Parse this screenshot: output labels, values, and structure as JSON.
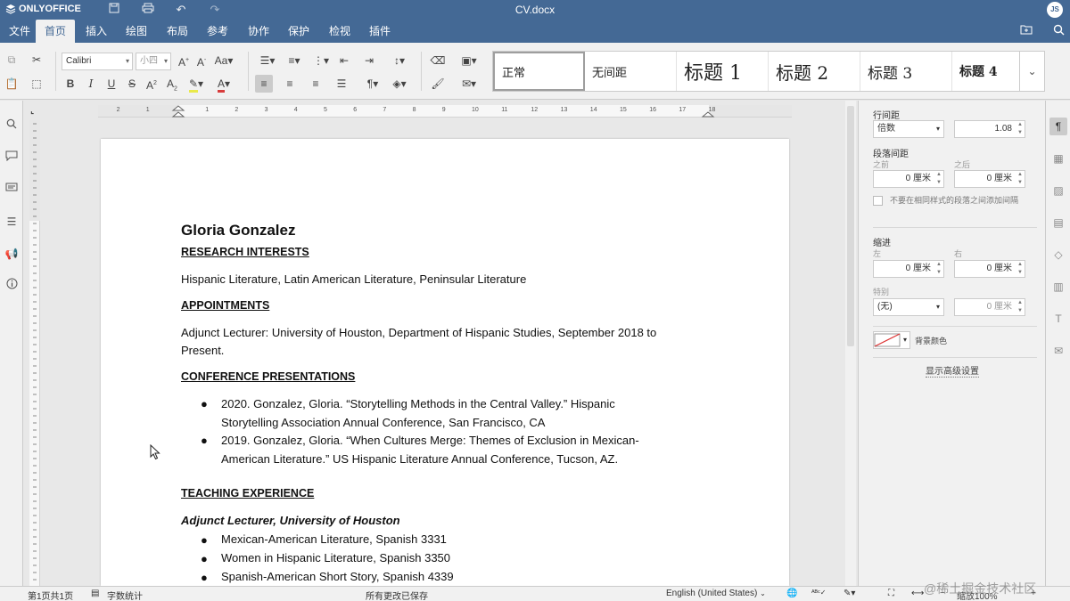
{
  "app": {
    "logo": "ONLYOFFICE",
    "doc_title": "CV.docx",
    "user_initials": "JS"
  },
  "menu": {
    "tabs": [
      "文件",
      "首页",
      "插入",
      "绘图",
      "布局",
      "参考",
      "协作",
      "保护",
      "检视",
      "插件"
    ],
    "active": "首页"
  },
  "toolbar": {
    "font_name": "Calibri",
    "font_size": "小四",
    "styles": [
      "正常",
      "无间距",
      "标题 1",
      "标题 2",
      "标题 3",
      "标题 4"
    ]
  },
  "document": {
    "name": "Gloria Gonzalez",
    "research_heading": "RESEARCH INTERESTS",
    "research_text": "Hispanic Literature, Latin American Literature, Peninsular Literature",
    "appointments_heading": "APPOINTMENTS",
    "appointments_text_1": "Adjunct Lecturer: University of Houston, Department of Hispanic Studies, September 2018 to",
    "appointments_text_2": "Present.",
    "conference_heading": "CONFERENCE PRESENTATIONS",
    "conference_items": [
      {
        "line1": "2020. Gonzalez, Gloria. “Storytelling Methods in the Central Valley.” Hispanic",
        "line2": "Storytelling Association Annual Conference, San Francisco, CA"
      },
      {
        "line1": "2019. Gonzalez, Gloria. “When Cultures Merge: Themes of Exclusion in Mexican-",
        "line2": "American Literature.” US Hispanic Literature Annual Conference, Tucson, AZ."
      }
    ],
    "teaching_heading": "TEACHING EXPERIENCE",
    "teaching_sub": "Adjunct Lecturer, University of Houston",
    "teaching_items": [
      "Mexican-American Literature, Spanish 3331",
      "Women in Hispanic Literature, Spanish 3350",
      "Spanish-American Short Story, Spanish 4339"
    ]
  },
  "ruler": {
    "marks": [
      "2",
      "1",
      "1",
      "2",
      "3",
      "4",
      "5",
      "6",
      "7",
      "8",
      "9",
      "10",
      "11",
      "12",
      "13",
      "14",
      "15",
      "16",
      "17",
      "18"
    ]
  },
  "right_panel": {
    "line_spacing_label": "行间距",
    "line_spacing_mode": "倍数",
    "line_spacing_value": "1.08",
    "para_spacing_label": "段落间距",
    "before_label": "之前",
    "after_label": "之后",
    "before_value": "0 厘米",
    "after_value": "0 厘米",
    "dont_add_interval": "不要在相同样式的段落之间添加间隔",
    "indent_label": "缩进",
    "left_label": "左",
    "right_label": "右",
    "left_value": "0 厘米",
    "right_value": "0 厘米",
    "special_label": "特别",
    "special_value": "(无)",
    "special_amount": "0 厘米",
    "bg_color_label": "背景颜色",
    "advanced_link": "显示高级设置"
  },
  "statusbar": {
    "page_info": "第1页共1页",
    "word_count": "字数统计",
    "save_status": "所有更改已保存",
    "language": "English (United States)",
    "zoom": "缩放100%",
    "watermark": "@稀土掘金技术社区"
  },
  "colors": {
    "brand": "#446995",
    "toolbar_bg": "#f1f1f1",
    "page_bg": "#ffffff"
  }
}
